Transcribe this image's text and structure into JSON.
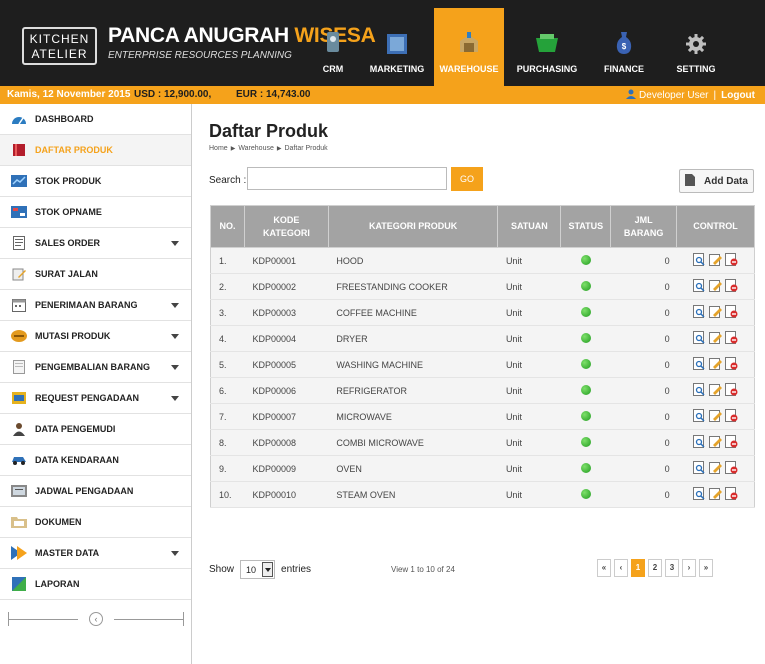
{
  "header": {
    "logo_line1": "KITCHEN",
    "logo_line2": "ATELIER",
    "brand_word1": "PANCA",
    "brand_word2": "ANUGRAH",
    "brand_word3": "WISESA",
    "brand_sub": "ENTERPRISE RESOURCES PLANNING",
    "nav": [
      {
        "label": "CRM",
        "icon": "crm-icon"
      },
      {
        "label": "MARKETING",
        "icon": "marketing-icon"
      },
      {
        "label": "WAREHOUSE",
        "icon": "warehouse-icon",
        "active": true
      },
      {
        "label": "PURCHASING",
        "icon": "purchasing-icon"
      },
      {
        "label": "FINANCE",
        "icon": "finance-icon"
      },
      {
        "label": "SETTING",
        "icon": "gear-icon"
      }
    ]
  },
  "subbar": {
    "date": "Kamis, 12 November 2015",
    "usd": "USD : 12,900.00,",
    "eur": "EUR : 14,743.00",
    "user": "Developer User",
    "separator": "|",
    "logout": "Logout"
  },
  "sidebar": {
    "items": [
      {
        "label": "DASHBOARD",
        "icon": "dashboard-icon"
      },
      {
        "label": "DAFTAR PRODUK",
        "icon": "product-icon",
        "active": true
      },
      {
        "label": "STOK PRODUK",
        "icon": "stock-icon"
      },
      {
        "label": "STOK OPNAME",
        "icon": "opname-icon"
      },
      {
        "label": "SALES ORDER",
        "icon": "sales-order-icon",
        "caret": true
      },
      {
        "label": "SURAT JALAN",
        "icon": "delivery-note-icon"
      },
      {
        "label": "PENERIMAAN BARANG",
        "icon": "receiving-icon",
        "caret": true
      },
      {
        "label": "MUTASI PRODUK",
        "icon": "mutation-icon",
        "caret": true
      },
      {
        "label": "PENGEMBALIAN BARANG",
        "icon": "return-icon",
        "caret": true
      },
      {
        "label": "REQUEST PENGADAAN",
        "icon": "request-icon",
        "caret": true
      },
      {
        "label": "DATA PENGEMUDI",
        "icon": "driver-icon"
      },
      {
        "label": "DATA KENDARAAN",
        "icon": "vehicle-icon"
      },
      {
        "label": "JADWAL PENGADAAN",
        "icon": "schedule-icon"
      },
      {
        "label": "DOKUMEN",
        "icon": "folder-icon"
      },
      {
        "label": "MASTER DATA",
        "icon": "master-data-icon",
        "caret": true
      },
      {
        "label": "LAPORAN",
        "icon": "report-icon"
      }
    ],
    "collapse_glyph": "‹"
  },
  "main": {
    "title": "Daftar Produk",
    "breadcrumb": [
      "Home",
      "Warehouse",
      "Daftar Produk"
    ],
    "breadcrumb_sep": "▶",
    "search_label": "Search :",
    "search_value": "",
    "go_label": "GO",
    "add_label": "Add Data",
    "columns": [
      "NO.",
      "KODE KATEGORI",
      "KATEGORI PRODUK",
      "SATUAN",
      "STATUS",
      "JML BARANG",
      "CONTROL"
    ],
    "column_lines": [
      [
        "NO."
      ],
      [
        "KODE",
        "KATEGORI"
      ],
      [
        "KATEGORI PRODUK"
      ],
      [
        "SATUAN"
      ],
      [
        "STATUS"
      ],
      [
        "JML",
        "BARANG"
      ],
      [
        "CONTROL"
      ]
    ],
    "rows": [
      {
        "no": "1.",
        "kode": "KDP00001",
        "kategori": "HOOD",
        "satuan": "Unit",
        "status": "active",
        "jml": "0"
      },
      {
        "no": "2.",
        "kode": "KDP00002",
        "kategori": "FREESTANDING COOKER",
        "satuan": "Unit",
        "status": "active",
        "jml": "0"
      },
      {
        "no": "3.",
        "kode": "KDP00003",
        "kategori": "COFFEE MACHINE",
        "satuan": "Unit",
        "status": "active",
        "jml": "0"
      },
      {
        "no": "4.",
        "kode": "KDP00004",
        "kategori": "DRYER",
        "satuan": "Unit",
        "status": "active",
        "jml": "0"
      },
      {
        "no": "5.",
        "kode": "KDP00005",
        "kategori": "WASHING MACHINE",
        "satuan": "Unit",
        "status": "active",
        "jml": "0"
      },
      {
        "no": "6.",
        "kode": "KDP00006",
        "kategori": "REFRIGERATOR",
        "satuan": "Unit",
        "status": "active",
        "jml": "0"
      },
      {
        "no": "7.",
        "kode": "KDP00007",
        "kategori": "MICROWAVE",
        "satuan": "Unit",
        "status": "active",
        "jml": "0"
      },
      {
        "no": "8.",
        "kode": "KDP00008",
        "kategori": "COMBI MICROWAVE",
        "satuan": "Unit",
        "status": "active",
        "jml": "0"
      },
      {
        "no": "9.",
        "kode": "KDP00009",
        "kategori": "OVEN",
        "satuan": "Unit",
        "status": "active",
        "jml": "0"
      },
      {
        "no": "10.",
        "kode": "KDP00010",
        "kategori": "STEAM OVEN",
        "satuan": "Unit",
        "status": "active",
        "jml": "0"
      }
    ],
    "show_label": "Show",
    "show_value": "10",
    "entries_label": "entries",
    "view_info": "View 1 to 10 of 24",
    "pager": [
      "«",
      "‹",
      "1",
      "2",
      "3",
      "›",
      "»"
    ],
    "pager_active": "1"
  },
  "colors": {
    "accent": "#f5a21b",
    "header_bg": "#1e1e1e",
    "table_header": "#a3a3a3",
    "status_active": "#2fb52f"
  }
}
